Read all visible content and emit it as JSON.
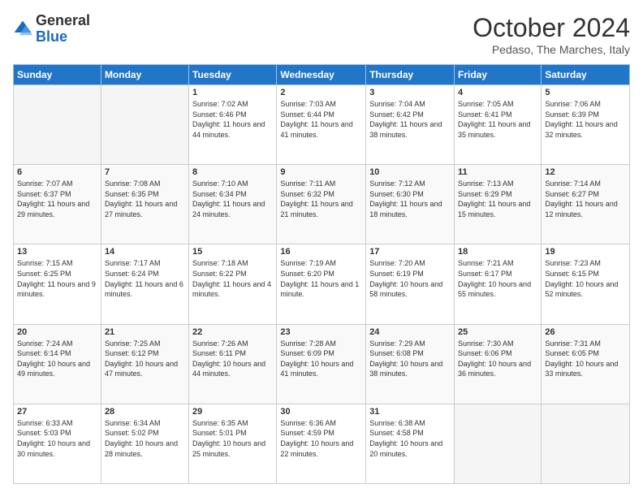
{
  "logo": {
    "general": "General",
    "blue": "Blue"
  },
  "header": {
    "month": "October 2024",
    "location": "Pedaso, The Marches, Italy"
  },
  "weekdays": [
    "Sunday",
    "Monday",
    "Tuesday",
    "Wednesday",
    "Thursday",
    "Friday",
    "Saturday"
  ],
  "weeks": [
    [
      {
        "day": "",
        "info": ""
      },
      {
        "day": "",
        "info": ""
      },
      {
        "day": "1",
        "info": "Sunrise: 7:02 AM\nSunset: 6:46 PM\nDaylight: 11 hours and 44 minutes."
      },
      {
        "day": "2",
        "info": "Sunrise: 7:03 AM\nSunset: 6:44 PM\nDaylight: 11 hours and 41 minutes."
      },
      {
        "day": "3",
        "info": "Sunrise: 7:04 AM\nSunset: 6:42 PM\nDaylight: 11 hours and 38 minutes."
      },
      {
        "day": "4",
        "info": "Sunrise: 7:05 AM\nSunset: 6:41 PM\nDaylight: 11 hours and 35 minutes."
      },
      {
        "day": "5",
        "info": "Sunrise: 7:06 AM\nSunset: 6:39 PM\nDaylight: 11 hours and 32 minutes."
      }
    ],
    [
      {
        "day": "6",
        "info": "Sunrise: 7:07 AM\nSunset: 6:37 PM\nDaylight: 11 hours and 29 minutes."
      },
      {
        "day": "7",
        "info": "Sunrise: 7:08 AM\nSunset: 6:35 PM\nDaylight: 11 hours and 27 minutes."
      },
      {
        "day": "8",
        "info": "Sunrise: 7:10 AM\nSunset: 6:34 PM\nDaylight: 11 hours and 24 minutes."
      },
      {
        "day": "9",
        "info": "Sunrise: 7:11 AM\nSunset: 6:32 PM\nDaylight: 11 hours and 21 minutes."
      },
      {
        "day": "10",
        "info": "Sunrise: 7:12 AM\nSunset: 6:30 PM\nDaylight: 11 hours and 18 minutes."
      },
      {
        "day": "11",
        "info": "Sunrise: 7:13 AM\nSunset: 6:29 PM\nDaylight: 11 hours and 15 minutes."
      },
      {
        "day": "12",
        "info": "Sunrise: 7:14 AM\nSunset: 6:27 PM\nDaylight: 11 hours and 12 minutes."
      }
    ],
    [
      {
        "day": "13",
        "info": "Sunrise: 7:15 AM\nSunset: 6:25 PM\nDaylight: 11 hours and 9 minutes."
      },
      {
        "day": "14",
        "info": "Sunrise: 7:17 AM\nSunset: 6:24 PM\nDaylight: 11 hours and 6 minutes."
      },
      {
        "day": "15",
        "info": "Sunrise: 7:18 AM\nSunset: 6:22 PM\nDaylight: 11 hours and 4 minutes."
      },
      {
        "day": "16",
        "info": "Sunrise: 7:19 AM\nSunset: 6:20 PM\nDaylight: 11 hours and 1 minute."
      },
      {
        "day": "17",
        "info": "Sunrise: 7:20 AM\nSunset: 6:19 PM\nDaylight: 10 hours and 58 minutes."
      },
      {
        "day": "18",
        "info": "Sunrise: 7:21 AM\nSunset: 6:17 PM\nDaylight: 10 hours and 55 minutes."
      },
      {
        "day": "19",
        "info": "Sunrise: 7:23 AM\nSunset: 6:15 PM\nDaylight: 10 hours and 52 minutes."
      }
    ],
    [
      {
        "day": "20",
        "info": "Sunrise: 7:24 AM\nSunset: 6:14 PM\nDaylight: 10 hours and 49 minutes."
      },
      {
        "day": "21",
        "info": "Sunrise: 7:25 AM\nSunset: 6:12 PM\nDaylight: 10 hours and 47 minutes."
      },
      {
        "day": "22",
        "info": "Sunrise: 7:26 AM\nSunset: 6:11 PM\nDaylight: 10 hours and 44 minutes."
      },
      {
        "day": "23",
        "info": "Sunrise: 7:28 AM\nSunset: 6:09 PM\nDaylight: 10 hours and 41 minutes."
      },
      {
        "day": "24",
        "info": "Sunrise: 7:29 AM\nSunset: 6:08 PM\nDaylight: 10 hours and 38 minutes."
      },
      {
        "day": "25",
        "info": "Sunrise: 7:30 AM\nSunset: 6:06 PM\nDaylight: 10 hours and 36 minutes."
      },
      {
        "day": "26",
        "info": "Sunrise: 7:31 AM\nSunset: 6:05 PM\nDaylight: 10 hours and 33 minutes."
      }
    ],
    [
      {
        "day": "27",
        "info": "Sunrise: 6:33 AM\nSunset: 5:03 PM\nDaylight: 10 hours and 30 minutes."
      },
      {
        "day": "28",
        "info": "Sunrise: 6:34 AM\nSunset: 5:02 PM\nDaylight: 10 hours and 28 minutes."
      },
      {
        "day": "29",
        "info": "Sunrise: 6:35 AM\nSunset: 5:01 PM\nDaylight: 10 hours and 25 minutes."
      },
      {
        "day": "30",
        "info": "Sunrise: 6:36 AM\nSunset: 4:59 PM\nDaylight: 10 hours and 22 minutes."
      },
      {
        "day": "31",
        "info": "Sunrise: 6:38 AM\nSunset: 4:58 PM\nDaylight: 10 hours and 20 minutes."
      },
      {
        "day": "",
        "info": ""
      },
      {
        "day": "",
        "info": ""
      }
    ]
  ]
}
